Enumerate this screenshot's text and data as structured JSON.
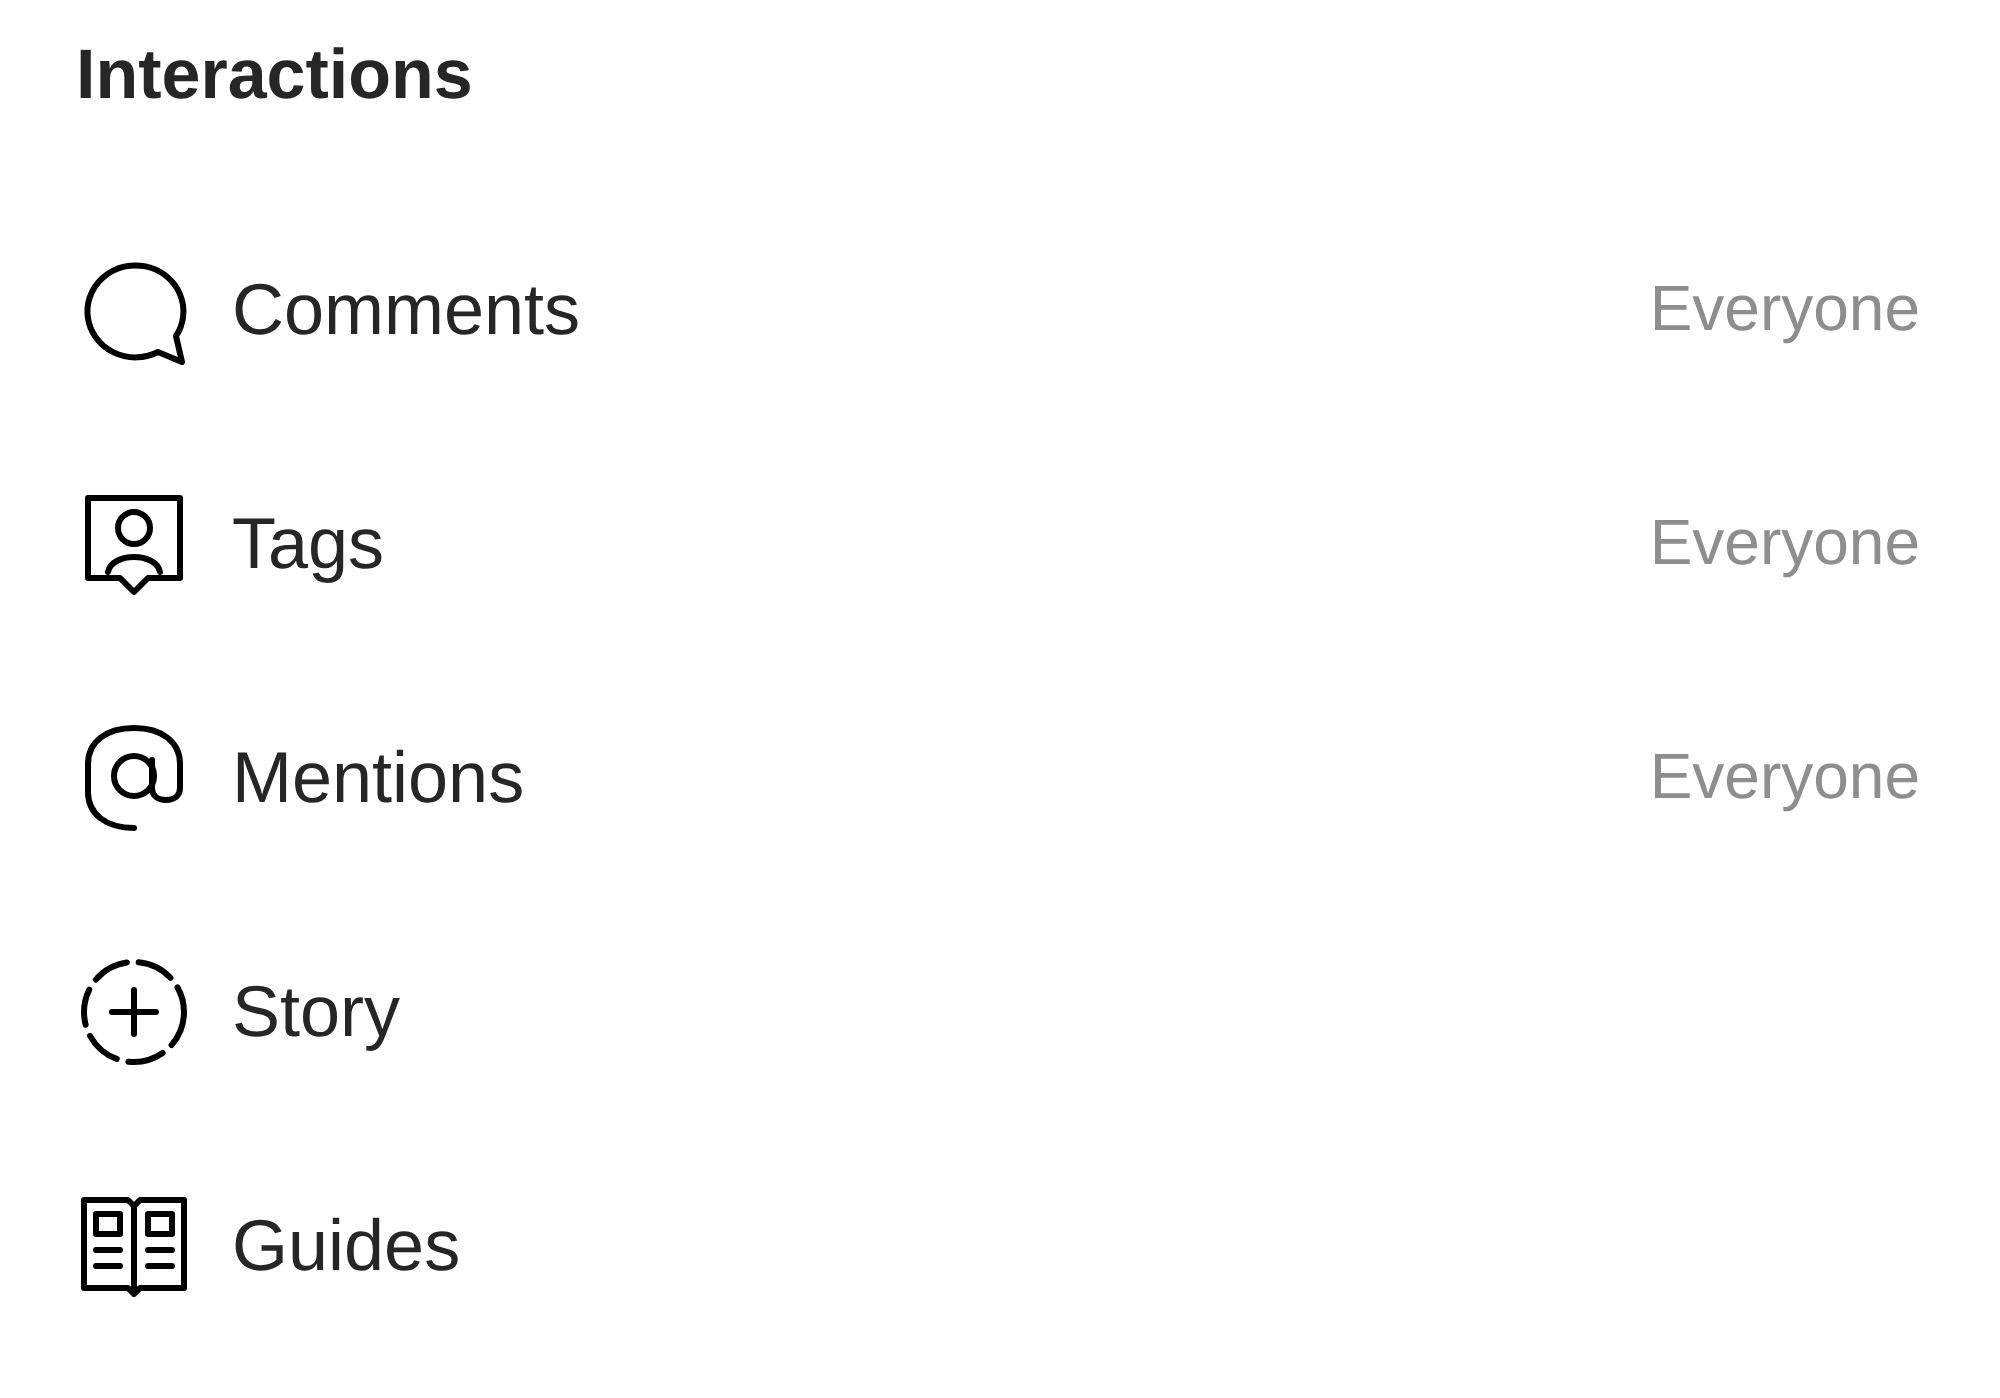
{
  "section": {
    "title": "Interactions"
  },
  "rows": [
    {
      "kind": "comments",
      "label": "Comments",
      "value": "Everyone"
    },
    {
      "kind": "tags",
      "label": "Tags",
      "value": "Everyone"
    },
    {
      "kind": "mentions",
      "label": "Mentions",
      "value": "Everyone"
    },
    {
      "kind": "story",
      "label": "Story"
    },
    {
      "kind": "guides",
      "label": "Guides"
    }
  ]
}
